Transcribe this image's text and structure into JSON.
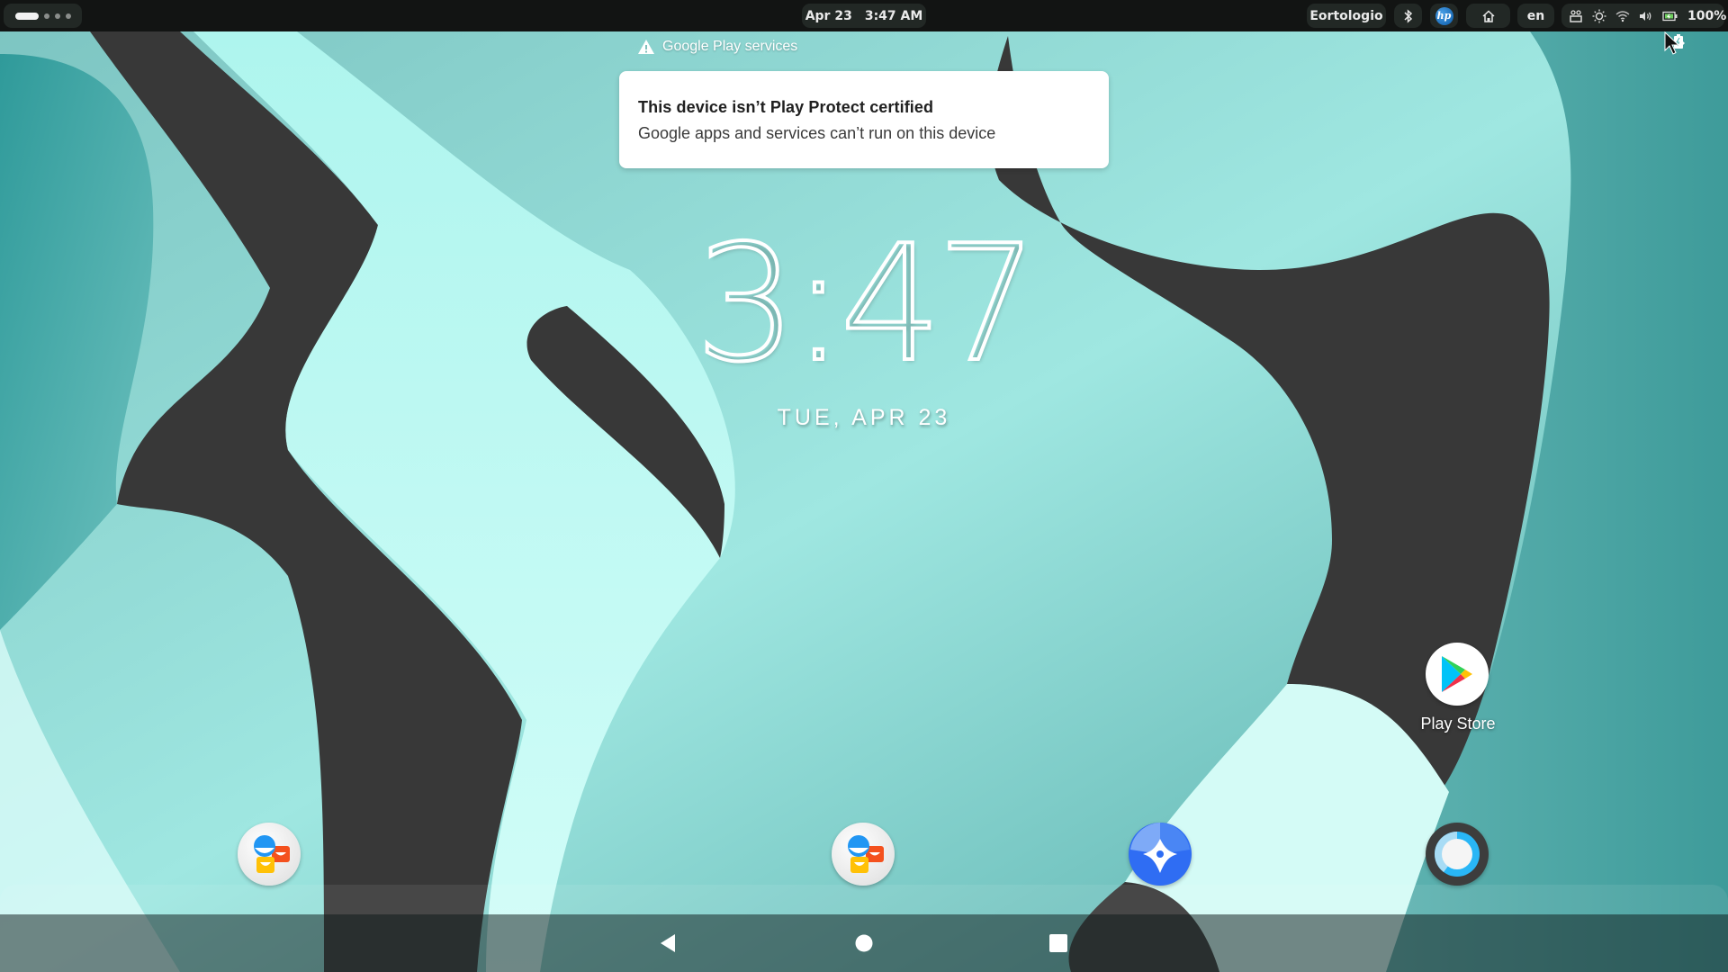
{
  "topbar": {
    "workspace_count": 4,
    "date": "Apr 23",
    "time": "3:47 AM",
    "extension_label": "Eortologio",
    "language": "en",
    "battery_percent": "100%",
    "icons": [
      "bluetooth-icon",
      "hp-icon",
      "home-icon",
      "screen-recorder-icon",
      "brightness-icon",
      "wifi-icon",
      "volume-icon",
      "battery-charging-icon"
    ]
  },
  "notification": {
    "app_name": "Google Play services",
    "title": "This device isn’t Play Protect certified",
    "body": "Google apps and services can’t run on this device"
  },
  "clock_widget": {
    "time": "3:47",
    "date": "TUE, APR 23"
  },
  "desktop": {
    "apps": [
      {
        "label": "Play Store",
        "icon": "play-store-icon"
      }
    ]
  },
  "dock": {
    "apps": [
      {
        "name": "contacts-app",
        "icon": "contacts-icon"
      },
      {
        "name": "contacts-app-2",
        "icon": "contacts-icon"
      },
      {
        "name": "compass-app",
        "icon": "compass-icon"
      },
      {
        "name": "camera-app",
        "icon": "camera-lens-icon"
      }
    ]
  },
  "navbar": {
    "buttons": [
      "back",
      "home",
      "recents"
    ]
  },
  "colors": {
    "topbar_bg": "#121413",
    "pill_bg": "#222825",
    "wallpaper_dark": "#383838",
    "wallpaper_light": "#c6fcf6",
    "wallpaper_teal": "#5fb3b1",
    "play_blue": "#00c3f8",
    "dock_blue": "#2f6df3"
  }
}
